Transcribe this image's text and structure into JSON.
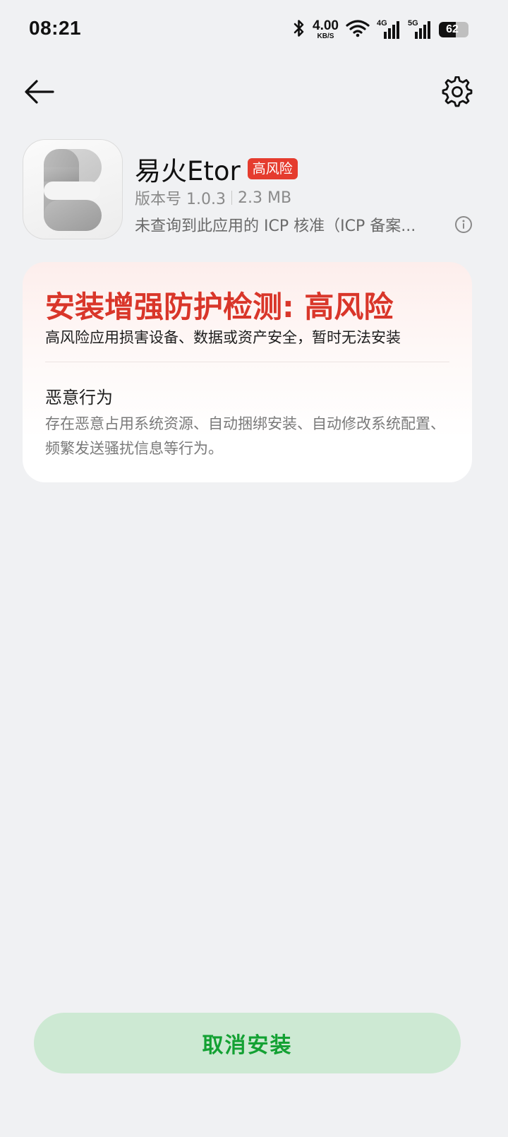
{
  "status_bar": {
    "time": "08:21",
    "net_speed_value": "4.00",
    "net_speed_unit": "KB/S",
    "signal_1_label": "4G",
    "signal_2_label": "5G",
    "battery_level": "62",
    "battery_percent": 62
  },
  "nav": {
    "back_icon": "arrow-left-icon",
    "settings_icon": "gear-icon"
  },
  "app": {
    "name": "易火Etor",
    "risk_badge": "高风险",
    "version": "版本号 1.0.3",
    "size": "2.3 MB",
    "icp_text": "未查询到此应用的 ICP 核准（ICP 备案...",
    "info_icon": "info-icon"
  },
  "warning": {
    "title": "安装增强防护检测: 高风险",
    "subtitle": "高风险应用损害设备、数据或资产安全，暂时无法安装",
    "section_title": "恶意行为",
    "section_desc": "存在恶意占用系统资源、自动捆绑安装、自动修改系统配置、频繁发送骚扰信息等行为。"
  },
  "actions": {
    "cancel_label": "取消安装"
  },
  "colors": {
    "danger": "#d9362a",
    "badge": "#e53c2e",
    "button_bg": "#cde9d3",
    "button_text": "#13a133",
    "page_bg": "#f0f1f3"
  }
}
